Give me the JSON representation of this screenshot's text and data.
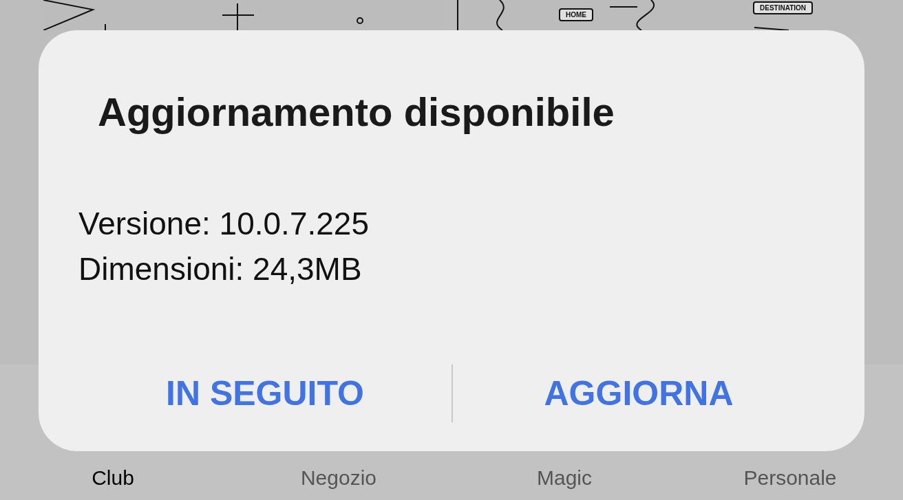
{
  "background_cards": [
    {
      "kind": "plan"
    },
    {
      "kind": "map",
      "labels": [
        "HOME",
        "DESTINATION"
      ]
    }
  ],
  "dialog": {
    "title": "Aggiornamento disponibile",
    "details": [
      "Versione: 10.0.7.225",
      "Dimensioni: 24,3MB"
    ],
    "buttons": [
      "IN SEGUITO",
      "AGGIORNA"
    ]
  },
  "bottom_nav": [
    {
      "label": "Club",
      "selected": true
    },
    {
      "label": "Negozio",
      "selected": false
    },
    {
      "label": "Magic",
      "selected": false
    },
    {
      "label": "Personale",
      "selected": false
    }
  ]
}
